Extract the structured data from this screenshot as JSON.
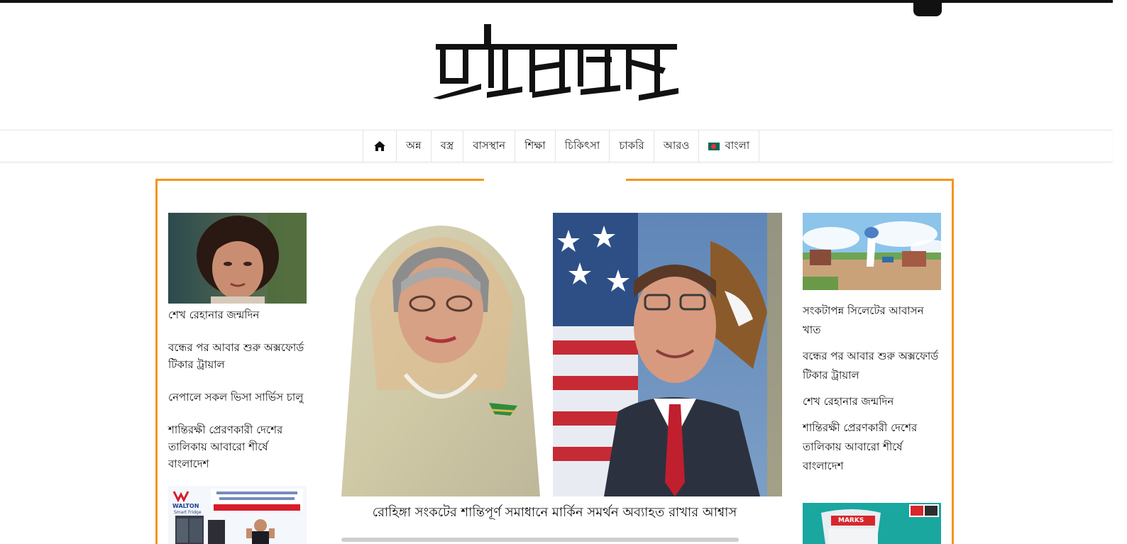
{
  "site": {
    "logo_text": "প্রতিবেদক"
  },
  "nav": {
    "home_icon": "home-icon",
    "items": [
      {
        "label": "অন্ন"
      },
      {
        "label": "বস্ত্র"
      },
      {
        "label": "বাসস্থান"
      },
      {
        "label": "শিক্ষা"
      },
      {
        "label": "চিকিৎসা"
      },
      {
        "label": "চাকরি"
      },
      {
        "label": "আরও"
      }
    ],
    "language": {
      "label": "বাংলা",
      "flag_icon": "bangladesh-flag-icon"
    }
  },
  "colors": {
    "accent": "#f7941d",
    "text": "#111111"
  },
  "left_column": {
    "headlines": [
      {
        "title": "শেখ রেহানার জন্মদিন"
      },
      {
        "title": "বন্ধের পর আবার শুরু অক্সফোর্ড টিকার ট্রায়াল"
      },
      {
        "title": "নেপালে সকল ভিসা সার্ভিস চালু"
      },
      {
        "title": "শান্তিরক্ষী প্রেরণকারী দেশের তালিকায় আবারো শীর্ষে বাংলাদেশ"
      }
    ],
    "ad": {
      "brand": "WALTON",
      "tagline": "Smart Fridge"
    }
  },
  "main_story": {
    "headline": "রোহিঙ্গা সংকটের শান্তিপূর্ণ সমাধানে মার্কিন সমর্থন অব্যাহত রাখার আশ্বাস"
  },
  "right_column": {
    "headlines": [
      {
        "title": "সংকটাপন্ন সিলেটের আবাসন খাত"
      },
      {
        "title": "বন্ধের পর আবার শুরু অক্সফোর্ড টিকার ট্রায়াল"
      },
      {
        "title": "শেখ রেহানার জন্মদিন"
      },
      {
        "title": "শান্তিরক্ষী প্রেরণকারী দেশের তালিকায় আবারো শীর্ষে বাংলাদেশ"
      }
    ],
    "ad": {
      "brand": "MARKS"
    }
  }
}
